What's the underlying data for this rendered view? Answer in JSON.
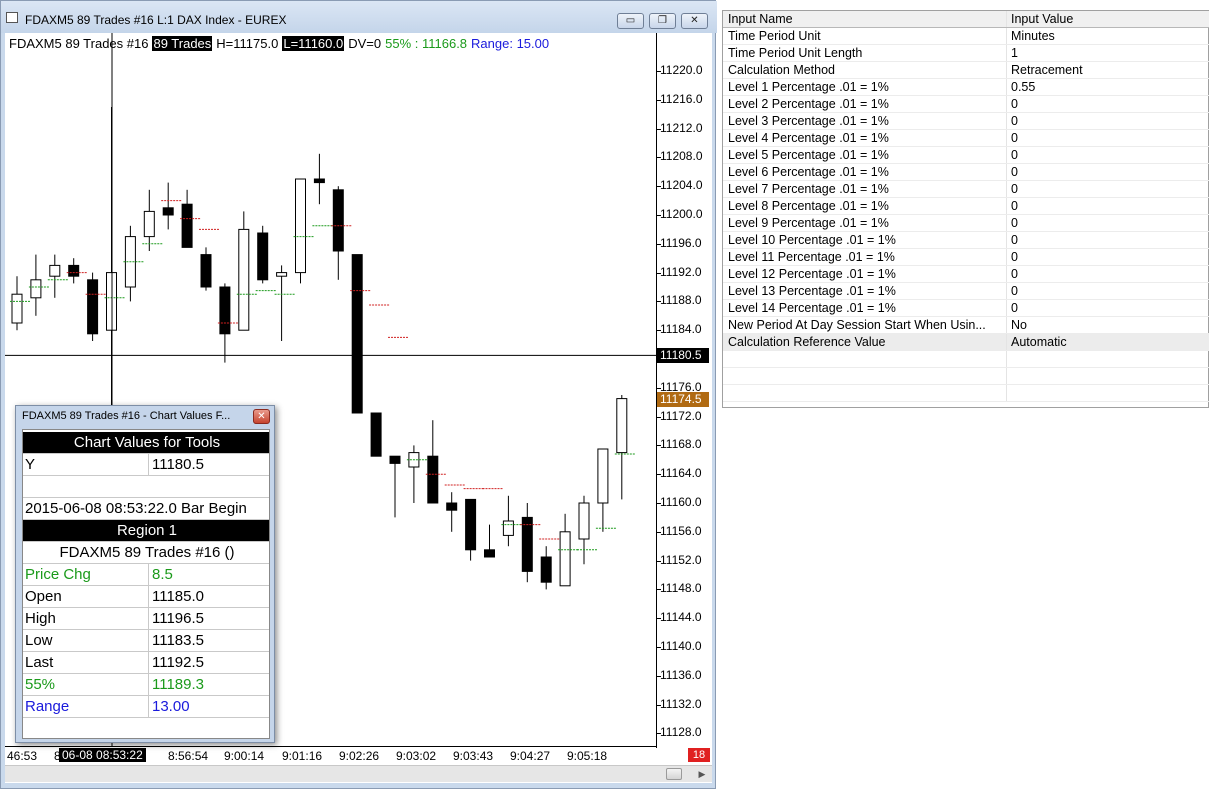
{
  "window": {
    "title": "FDAXM5  89 Trades  #16  L:1  DAX Index - EUREX",
    "minimize_glyph": "▭",
    "restore_glyph": "❐",
    "close_glyph": "✕"
  },
  "info_bar": {
    "symbol": "FDAXM5  89 Trades  #16",
    "bar_type": "89 Trades",
    "high": "H=11175.0",
    "low": "L=11160.0",
    "dv": "DV=0",
    "pct": "55% : 11166.8",
    "range": "Range: 15.00"
  },
  "price_axis": {
    "ticks": [
      "11220.0",
      "11216.0",
      "11212.0",
      "11208.0",
      "11204.0",
      "11200.0",
      "11196.0",
      "11192.0",
      "11188.0",
      "11184.0",
      "11176.0",
      "11172.0",
      "11168.0",
      "11164.0",
      "11160.0",
      "11156.0",
      "11152.0",
      "11148.0",
      "11144.0",
      "11140.0",
      "11136.0",
      "11132.0",
      "11128.0"
    ],
    "crosshair_label": "11180.5",
    "last_label": "11174.5",
    "last_color": "#b06a12"
  },
  "time_axis": {
    "labels": [
      "46:53",
      "8",
      "8:56:54",
      "9:00:14",
      "9:01:16",
      "9:02:26",
      "9:03:02",
      "9:03:43",
      "9:04:27",
      "9:05:18"
    ],
    "cursor_label": "06-08   08:53:22",
    "countdown": "18"
  },
  "chart_data": {
    "type": "candlestick",
    "y_axis": {
      "min": 11126,
      "max": 11222,
      "crosshair": 11180.5,
      "last": 11174.5
    },
    "candles": [
      {
        "o": 11185.0,
        "h": 11191.5,
        "l": 11184.0,
        "c": 11189.0,
        "m": 11188.0
      },
      {
        "o": 11188.5,
        "h": 11194.5,
        "l": 11186.0,
        "c": 11191.0,
        "m": 11190.0
      },
      {
        "o": 11191.5,
        "h": 11194.5,
        "l": 11188.5,
        "c": 11193.0,
        "m": 11191.0
      },
      {
        "o": 11193.0,
        "h": 11194.0,
        "l": 11190.5,
        "c": 11191.5,
        "m": 11192.0
      },
      {
        "o": 11191.0,
        "h": 11192.0,
        "l": 11182.5,
        "c": 11183.5,
        "m": 11189.0
      },
      {
        "o": 11184.0,
        "h": 11215.0,
        "l": 11172.0,
        "c": 11192.0,
        "m": 11188.5
      },
      {
        "o": 11190.0,
        "h": 11198.5,
        "l": 11188.0,
        "c": 11197.0,
        "m": 11193.5
      },
      {
        "o": 11197.0,
        "h": 11203.5,
        "l": 11195.0,
        "c": 11200.5,
        "m": 11196.0
      },
      {
        "o": 11201.0,
        "h": 11204.5,
        "l": 11198.0,
        "c": 11200.0,
        "m": 11202.0
      },
      {
        "o": 11201.5,
        "h": 11203.5,
        "l": 11195.5,
        "c": 11195.5,
        "m": 11199.5
      },
      {
        "o": 11194.5,
        "h": 11195.5,
        "l": 11189.5,
        "c": 11190.0,
        "m": 11198.0
      },
      {
        "o": 11190.0,
        "h": 11190.5,
        "l": 11179.5,
        "c": 11183.5,
        "m": 11185.0
      },
      {
        "o": 11184.0,
        "h": 11200.5,
        "l": 11184.0,
        "c": 11198.0,
        "m": 11189.0
      },
      {
        "o": 11197.5,
        "h": 11198.5,
        "l": 11190.5,
        "c": 11191.0,
        "m": 11189.5
      },
      {
        "o": 11191.5,
        "h": 11193.0,
        "l": 11182.5,
        "c": 11192.0,
        "m": 11189.0
      },
      {
        "o": 11192.0,
        "h": 11205.0,
        "l": 11190.5,
        "c": 11205.0,
        "m": 11197.0
      },
      {
        "o": 11205.0,
        "h": 11208.5,
        "l": 11201.5,
        "c": 11204.5,
        "m": 11198.5
      },
      {
        "o": 11203.5,
        "h": 11204.0,
        "l": 11191.0,
        "c": 11195.0,
        "m": 11198.5
      },
      {
        "o": 11194.5,
        "h": 11194.5,
        "l": 11180.5,
        "c": 11172.5,
        "m": 11189.5
      },
      {
        "o": 11172.5,
        "h": 11172.5,
        "l": 11166.5,
        "c": 11166.5,
        "m": 11187.5
      },
      {
        "o": 11166.5,
        "h": 11166.5,
        "l": 11158.0,
        "c": 11165.5,
        "m": 11183.0
      },
      {
        "o": 11165.0,
        "h": 11168.0,
        "l": 11160.0,
        "c": 11167.0,
        "m": 11166.0
      },
      {
        "o": 11166.5,
        "h": 11171.5,
        "l": 11160.0,
        "c": 11160.0,
        "m": 11164.0
      },
      {
        "o": 11160.0,
        "h": 11161.5,
        "l": 11156.0,
        "c": 11159.0,
        "m": 11162.5
      },
      {
        "o": 11160.5,
        "h": 11160.5,
        "l": 11152.0,
        "c": 11153.5,
        "m": 11162.0
      },
      {
        "o": 11153.5,
        "h": 11157.0,
        "l": 11152.5,
        "c": 11152.5,
        "m": 11162.0
      },
      {
        "o": 11155.5,
        "h": 11161.0,
        "l": 11154.0,
        "c": 11157.5,
        "m": 11157.0
      },
      {
        "o": 11158.0,
        "h": 11160.0,
        "l": 11149.0,
        "c": 11150.5,
        "m": 11157.0
      },
      {
        "o": 11152.5,
        "h": 11154.0,
        "l": 11148.0,
        "c": 11149.0,
        "m": 11155.0
      },
      {
        "o": 11148.5,
        "h": 11158.5,
        "l": 11148.5,
        "c": 11156.0,
        "m": 11153.5
      },
      {
        "o": 11155.0,
        "h": 11161.0,
        "l": 11151.5,
        "c": 11160.0,
        "m": 11153.5
      },
      {
        "o": 11160.0,
        "h": 11167.5,
        "l": 11156.0,
        "c": 11167.5,
        "m": 11156.5
      },
      {
        "o": 11167.0,
        "h": 11175.0,
        "l": 11160.5,
        "c": 11174.5,
        "m": 11166.8
      }
    ]
  },
  "tool_window": {
    "title": "FDAXM5  89 Trades  #16 - Chart Values F...",
    "close_glyph": "✕",
    "header": "Chart Values for Tools",
    "y_label": "Y",
    "y_value": "11180.5",
    "datetime": "2015-06-08   08:53:22.0  Bar Begin",
    "region": "Region 1",
    "symbol": "FDAXM5  89 Trades  #16 ()",
    "rows": [
      {
        "label": "Price Chg",
        "value": "8.5",
        "color": "#1b9a1b"
      },
      {
        "label": "Open",
        "value": "11185.0",
        "color": "#000000"
      },
      {
        "label": "High",
        "value": "11196.5",
        "color": "#000000"
      },
      {
        "label": "Low",
        "value": "11183.5",
        "color": "#000000"
      },
      {
        "label": "Last",
        "value": "11192.5",
        "color": "#000000"
      },
      {
        "label": "55%",
        "value": "11189.3",
        "color": "#1b9a1b"
      },
      {
        "label": "Range",
        "value": "13.00",
        "color": "#1a1adc"
      }
    ]
  },
  "input_panel": {
    "col_name": "Input Name",
    "col_value": "Input Value",
    "rows": [
      {
        "name": "Time Period Unit",
        "value": "Minutes"
      },
      {
        "name": "Time Period Unit Length",
        "value": "1"
      },
      {
        "name": "Calculation Method",
        "value": "Retracement"
      },
      {
        "name": "Level 1 Percentage .01 = 1%",
        "value": "0.55"
      },
      {
        "name": "Level 2 Percentage .01 = 1%",
        "value": "0"
      },
      {
        "name": "Level 3 Percentage .01 = 1%",
        "value": "0"
      },
      {
        "name": "Level 4 Percentage .01 = 1%",
        "value": "0"
      },
      {
        "name": "Level 5 Percentage .01 = 1%",
        "value": "0"
      },
      {
        "name": "Level 6 Percentage .01 = 1%",
        "value": "0"
      },
      {
        "name": "Level 7 Percentage .01 = 1%",
        "value": "0"
      },
      {
        "name": "Level 8 Percentage .01 = 1%",
        "value": "0"
      },
      {
        "name": "Level 9 Percentage .01 = 1%",
        "value": "0"
      },
      {
        "name": "Level 10 Percentage .01 = 1%",
        "value": "0"
      },
      {
        "name": "Level 11 Percentage .01 = 1%",
        "value": "0"
      },
      {
        "name": "Level 12 Percentage .01 = 1%",
        "value": "0"
      },
      {
        "name": "Level 13 Percentage .01 = 1%",
        "value": "0"
      },
      {
        "name": "Level 14 Percentage .01 = 1%",
        "value": "0"
      },
      {
        "name": "New Period At Day Session Start When Usin...",
        "value": "No"
      },
      {
        "name": "Calculation Reference Value",
        "value": "Automatic"
      }
    ]
  }
}
